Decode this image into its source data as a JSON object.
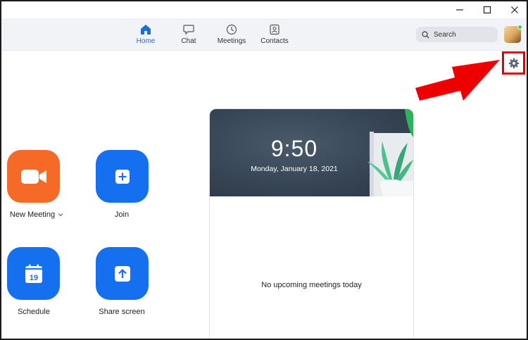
{
  "window": {
    "minimize_glyph": "—",
    "maximize_glyph": "☐",
    "close_glyph": "✕"
  },
  "nav": {
    "tabs": [
      {
        "label": "Home",
        "icon": "home-icon",
        "active": true
      },
      {
        "label": "Chat",
        "icon": "chat-icon"
      },
      {
        "label": "Meetings",
        "icon": "clock-icon"
      },
      {
        "label": "Contacts",
        "icon": "contacts-icon"
      }
    ],
    "search_placeholder": "Search",
    "avatar_status": "online"
  },
  "actions": {
    "new_meeting": "New Meeting",
    "join": "Join",
    "schedule": "Schedule",
    "schedule_day": "19",
    "share_screen": "Share screen"
  },
  "panel": {
    "time": "9:50",
    "date": "Monday, January 18, 2021",
    "empty_message": "No upcoming meetings today"
  },
  "colors": {
    "accent": "#1570ef",
    "new_meeting": "#f56a27",
    "highlight": "#e00000",
    "online": "#2ecc71"
  }
}
